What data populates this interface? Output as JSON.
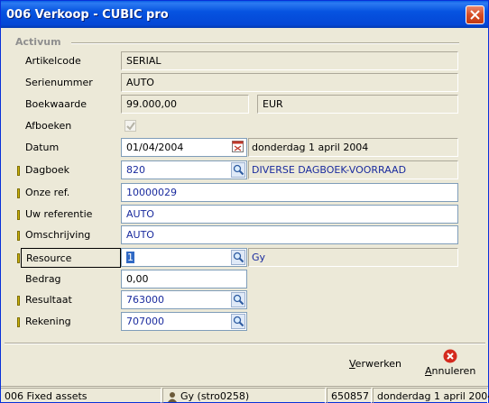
{
  "window": {
    "title": "006 Verkoop - CUBIC pro"
  },
  "group": {
    "title": "Activum"
  },
  "fields": {
    "artikelcode": {
      "label": "Artikelcode",
      "value": "SERIAL"
    },
    "serienummer": {
      "label": "Serienummer",
      "value": "AUTO"
    },
    "boekwaarde": {
      "label": "Boekwaarde",
      "value": "99.000,00",
      "currency": "EUR"
    },
    "afboeken": {
      "label": "Afboeken",
      "checked": true
    },
    "datum": {
      "label": "Datum",
      "value": "01/04/2004",
      "description": "donderdag 1 april 2004"
    },
    "dagboek": {
      "label": "Dagboek",
      "value": "820",
      "description": "DIVERSE DAGBOEK-VOORRAAD"
    },
    "onze_ref": {
      "label": "Onze ref.",
      "value": "10000029"
    },
    "uw_referentie": {
      "label": "Uw referentie",
      "value": "AUTO"
    },
    "omschrijving": {
      "label": "Omschrijving",
      "value": "AUTO"
    },
    "resource": {
      "label": "Resource",
      "value": "1",
      "description": "Gy"
    },
    "bedrag": {
      "label": "Bedrag",
      "value": "0,00"
    },
    "resultaat": {
      "label": "Resultaat",
      "value": "763000"
    },
    "rekening": {
      "label": "Rekening",
      "value": "707000"
    }
  },
  "buttons": {
    "verwerken": {
      "label": "Verwerken"
    },
    "annuleren": {
      "label": "Annuleren"
    }
  },
  "statusbar": {
    "module": "006 Fixed assets",
    "user": "Gy (stro0258)",
    "number": "650857",
    "date": "donderdag 1 april 2004"
  },
  "colors": {
    "titlebar": "#0653e0",
    "link_text": "#1a2b9e",
    "marker": "#c9b000",
    "close": "#d64b23"
  }
}
